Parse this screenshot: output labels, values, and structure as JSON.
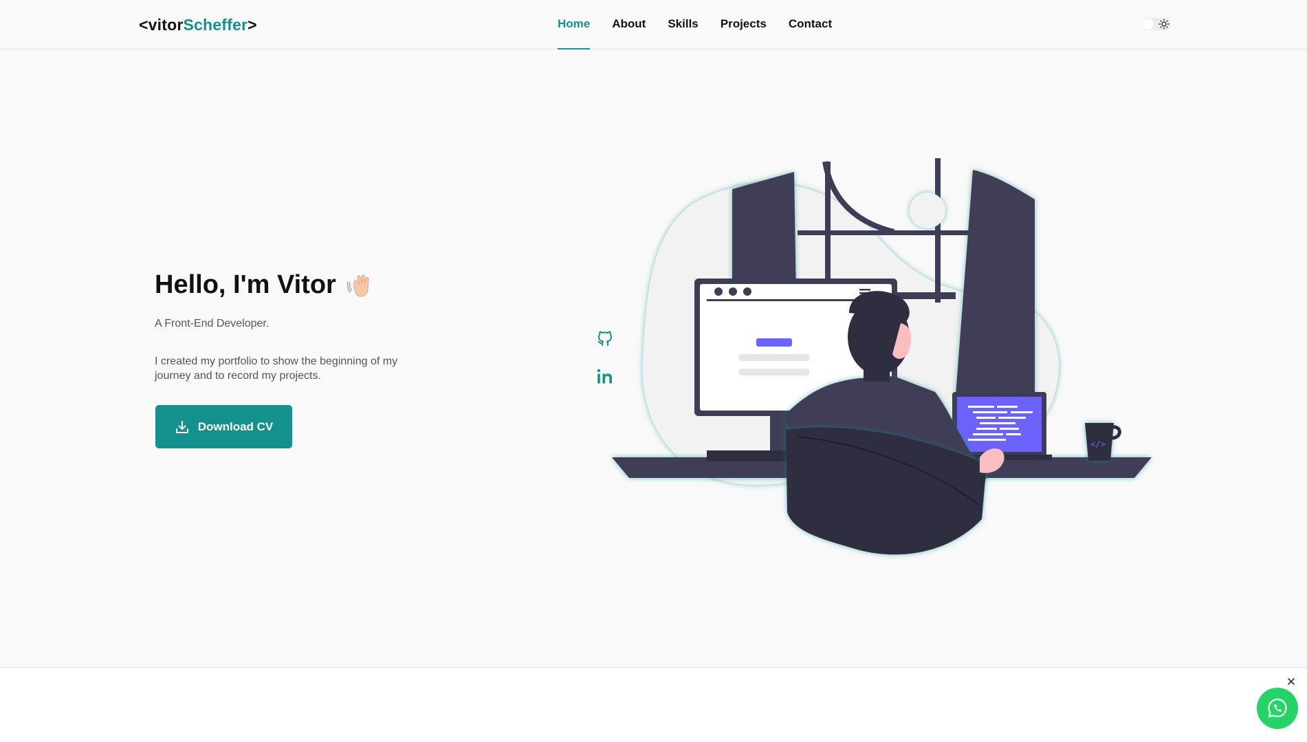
{
  "header": {
    "logo": {
      "lt": "<",
      "name": "vitor",
      "highlight": "Scheffer",
      "gt": ">"
    },
    "nav": [
      {
        "label": "Home",
        "active": true
      },
      {
        "label": "About",
        "active": false
      },
      {
        "label": "Skills",
        "active": false
      },
      {
        "label": "Projects",
        "active": false
      },
      {
        "label": "Contact",
        "active": false
      }
    ],
    "theme_toggle_icon": "sun-icon"
  },
  "hero": {
    "title": "Hello, I'm Vitor",
    "title_icon": "waving-hand-icon",
    "subtitle": "A Front-End Developer.",
    "description": "I created my portfolio to show the beginning of my journey and to record my projects.",
    "cta": {
      "label": "Download CV",
      "icon": "download-icon"
    }
  },
  "social": [
    {
      "name": "github",
      "icon": "github-icon"
    },
    {
      "name": "linkedin",
      "icon": "linkedin-icon"
    }
  ],
  "floating": {
    "whatsapp_icon": "whatsapp-icon",
    "close_icon": "close-icon"
  },
  "colors": {
    "accent": "#14918c",
    "dark": "#3f3d56",
    "screen": "#6c63ff",
    "whatsapp": "#25d366"
  }
}
